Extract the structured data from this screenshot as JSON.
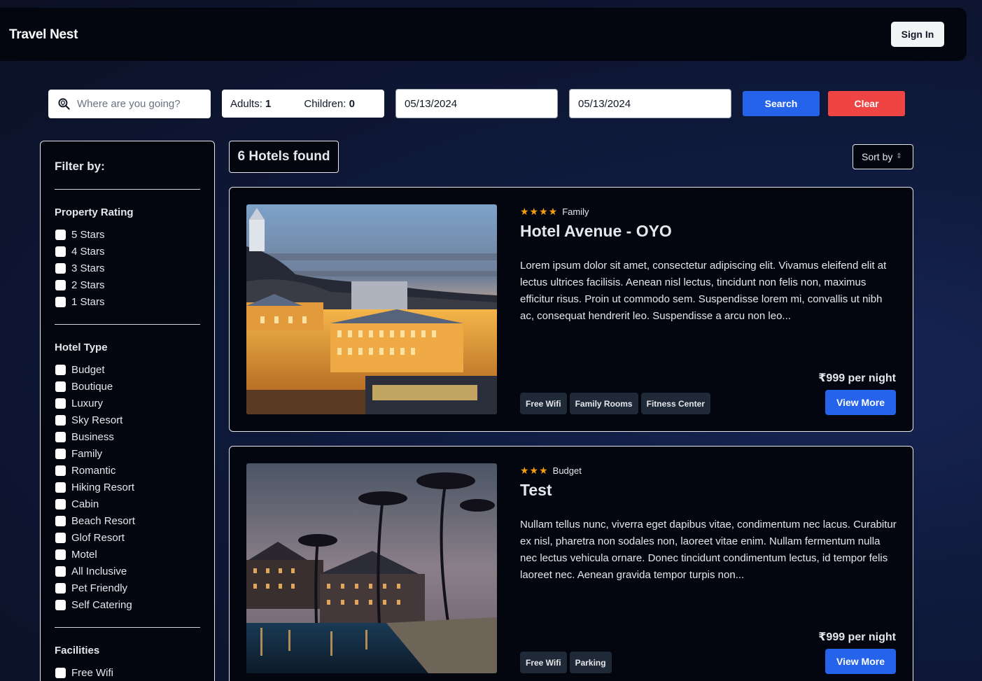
{
  "app": {
    "brand": "Travel Nest",
    "signin_label": "Sign In"
  },
  "search": {
    "destination_placeholder": "Where are you going?",
    "adults_label": "Adults:",
    "adults_value": "1",
    "children_label": "Children:",
    "children_value": "0",
    "checkin": "05/13/2024",
    "checkout": "05/13/2024",
    "search_label": "Search",
    "clear_label": "Clear"
  },
  "filters": {
    "title": "Filter by:",
    "rating": {
      "title": "Property Rating",
      "options": [
        "5 Stars",
        "4 Stars",
        "3 Stars",
        "2 Stars",
        "1 Stars"
      ]
    },
    "hotel_type": {
      "title": "Hotel Type",
      "options": [
        "Budget",
        "Boutique",
        "Luxury",
        "Sky Resort",
        "Business",
        "Family",
        "Romantic",
        "Hiking Resort",
        "Cabin",
        "Beach Resort",
        "Glof Resort",
        "Motel",
        "All Inclusive",
        "Pet Friendly",
        "Self Catering"
      ]
    },
    "facilities": {
      "title": "Facilities",
      "options": [
        "Free Wifi"
      ]
    }
  },
  "results": {
    "count_label": "6 Hotels found",
    "sort_label": "Sort by",
    "hotels": [
      {
        "stars": "★★★★",
        "type": "Family",
        "name": "Hotel Avenue - OYO",
        "description": "Lorem ipsum dolor sit amet, consectetur adipiscing elit. Vivamus eleifend elit at lectus ultrices facilisis. Aenean nisl lectus, tincidunt non felis non, maximus efficitur risus. Proin ut commodo sem. Suspendisse lorem mi, convallis ut nibh ac, consequat hendrerit leo. Suspendisse a arcu non leo...",
        "facilities": [
          "Free Wifi",
          "Family Rooms",
          "Fitness Center"
        ],
        "price": "₹999 per night",
        "cta": "View More"
      },
      {
        "stars": "★★★",
        "type": "Budget",
        "name": "Test",
        "description": "Nullam tellus nunc, viverra eget dapibus vitae, condimentum nec lacus. Curabitur ex nisl, pharetra non sodales non, laoreet vitae enim. Nullam fermentum nulla nec lectus vehicula ornare. Donec tincidunt condimentum lectus, id tempor felis laoreet nec. Aenean gravida tempor turpis non...",
        "facilities": [
          "Free Wifi",
          "Parking"
        ],
        "price": "₹999 per night",
        "cta": "View More"
      }
    ]
  },
  "colors": {
    "primary": "#2563eb",
    "danger": "#ef4444",
    "star": "#f59e0b",
    "surface": "#03050f"
  }
}
